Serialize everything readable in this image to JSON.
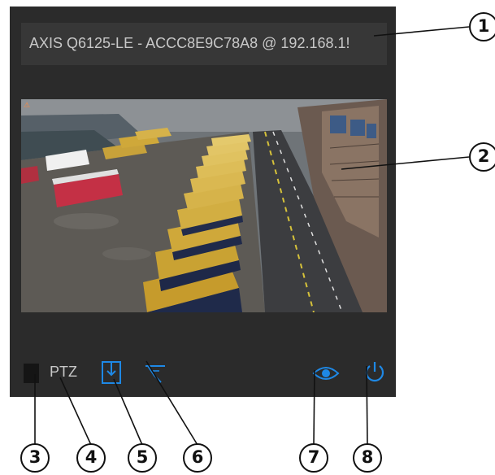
{
  "camera": {
    "title": "AXIS Q6125-LE - ACCC8E9C78A8 @ 192.168.1!",
    "overlay_text": "",
    "overlay_warn": "⚠"
  },
  "toolbar": {
    "ptz_label": "PTZ"
  },
  "callouts": [
    "1",
    "2",
    "3",
    "4",
    "5",
    "6",
    "7",
    "8"
  ],
  "colors": {
    "panel": "#2b2b2b",
    "title_bar": "#373737",
    "accent": "#1e88e5",
    "text": "#c8c8c8"
  },
  "icons": {
    "focus": "focus-box",
    "ptz_mode": "ptz-mode-icon",
    "preset": "preset-position-icon",
    "view": "eye-icon",
    "power": "power-icon"
  }
}
